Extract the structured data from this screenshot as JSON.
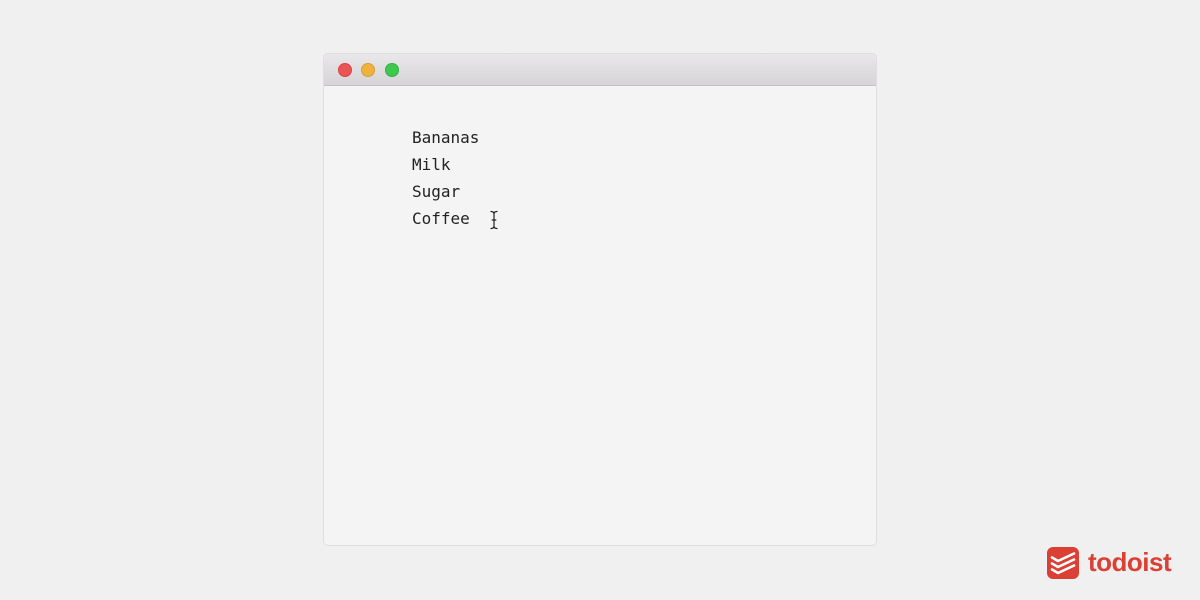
{
  "window": {
    "list_items": [
      "Bananas",
      "Milk",
      "Sugar",
      "Coffee"
    ],
    "cursor_icon": "text-cursor-icon"
  },
  "brand": {
    "name": "todoist",
    "color": "#db4035",
    "icon": "todoist-logo-icon"
  },
  "colors": {
    "background": "#f1f0f0",
    "window_bg": "#f4f4f4",
    "close": "#ec5353",
    "minimize": "#eeb33f",
    "maximize": "#3ec84e"
  }
}
